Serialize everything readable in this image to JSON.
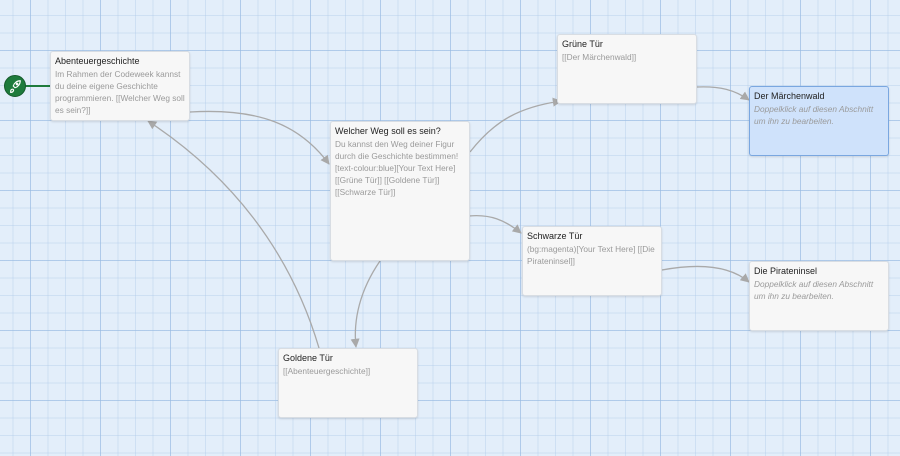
{
  "passages": [
    {
      "title": "Abenteuergeschichte",
      "excerpt": "Im Rahmen der Codeweek kannst du deine eigene Geschichte programmieren. [[Welcher Weg soll es sein?]]"
    },
    {
      "title": "Grüne Tür",
      "excerpt": "[[Der Märchenwald]]"
    },
    {
      "title": "Der Märchenwald",
      "excerpt": "Doppelklick auf diesen Abschnitt um ihn zu bearbeiten."
    },
    {
      "title": "Welcher Weg soll es sein?",
      "excerpt": "Du kannst den Weg deiner Figur durch die Geschichte bestimmen! [text-colour:blue][Your Text Here] [[Grüne Tür]] [[Goldene Tür]] [[Schwarze Tür]]"
    },
    {
      "title": "Schwarze Tür",
      "excerpt": "(bg:magenta)[Your Text Here] [[Die Pirateninsel]]"
    },
    {
      "title": "Die Pirateninsel",
      "excerpt": "Doppelklick auf diesen Abschnitt um ihn zu bearbeiten."
    },
    {
      "title": "Goldene Tür",
      "excerpt": "[[Abenteuergeschichte]]"
    }
  ],
  "start_marker_icon": "rocket-icon",
  "colors": {
    "canvas": "#e3eefa",
    "passage": "#f7f7f7",
    "selected_passage": "#cfe2fb",
    "start_marker": "#1e7b3c",
    "arrow": "#a9a9a9"
  }
}
